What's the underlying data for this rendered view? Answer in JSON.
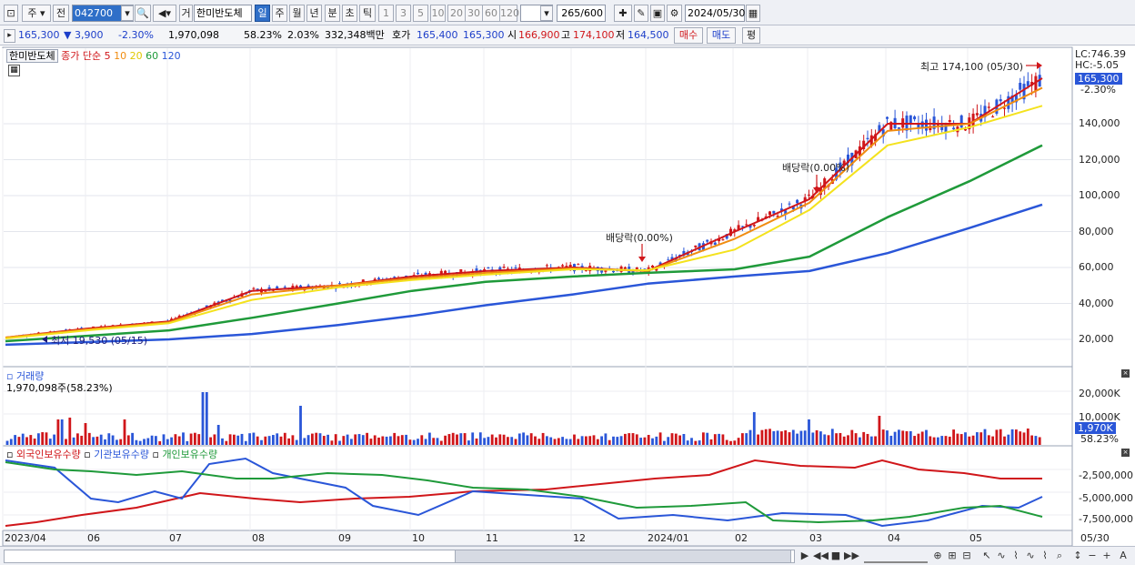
{
  "toolbar": {
    "period_label": "주",
    "prev_label": "전",
    "stock_code": "042700",
    "group_label": "거",
    "stock_name": "한미반도체",
    "tabs": [
      "일",
      "주",
      "월",
      "년",
      "분",
      "초",
      "틱"
    ],
    "active_tab": "일",
    "intervals": [
      "1",
      "3",
      "5",
      "10",
      "20",
      "30",
      "60",
      "120"
    ],
    "count_value": "265",
    "count_total": "/600",
    "date_value": "2024/05/30"
  },
  "quote": {
    "price": "165,300",
    "change": "▼ 3,900",
    "change_pct": "-2.30%",
    "volume": "1,970,098",
    "turnover_pct": "58.23%",
    "ratio": "2.03%",
    "amount": "332,348백만",
    "bid_label": "호가",
    "bid1": "165,400",
    "bid2": "165,300",
    "open_label": "시",
    "open": "166,900",
    "high_label": "고",
    "high": "174,100",
    "low_label": "저",
    "low": "164,500",
    "buy_label": "매수",
    "sell_label": "매도",
    "eval_label": "평"
  },
  "legend": {
    "stock": "한미반도체",
    "ma_title": "종가 단순",
    "ma_periods": [
      "5",
      "10",
      "20",
      "60",
      "120"
    ],
    "ma_colors": [
      "#d0161a",
      "#f08c10",
      "#f4e21e",
      "#1f9a3a",
      "#2a56d8"
    ]
  },
  "price_axis": {
    "ticks": [
      "140,000",
      "120,000",
      "100,000",
      "80,000",
      "60,000",
      "40,000",
      "20,000"
    ],
    "lc": "LC:746.39",
    "hc": "HC:-5.05",
    "last_price": "165,300",
    "last_pct": "-2.30%"
  },
  "annotations": {
    "high": "최고 174,100 (05/30)",
    "low": "최저 19,530 (05/15)",
    "div1": "배당락(0.00%)",
    "div2": "배당락(0.00%)"
  },
  "volume": {
    "title": "거래량",
    "value": "1,970,098주(58.23%)",
    "ticks": [
      "20,000K",
      "10,000K"
    ],
    "last": "1,970K",
    "last_pct": "58.23%"
  },
  "holdings": {
    "series": [
      "외국인보유수량",
      "기관보유수량",
      "개인보유수량"
    ],
    "colors": [
      "#d0161a",
      "#2a56d8",
      "#1f9a3a"
    ],
    "ticks": [
      "-2,500,000",
      "-5,000,000",
      "-7,500,000"
    ]
  },
  "x_axis": {
    "labels": [
      "2023/04",
      "06",
      "07",
      "08",
      "09",
      "10",
      "11",
      "12",
      "2024/01",
      "02",
      "03",
      "04",
      "05"
    ],
    "end_label": "05/30"
  },
  "chart_data": [
    {
      "type": "line",
      "title": "",
      "ylim": [
        0,
        180000
      ],
      "series": [
        {
          "name": "5",
          "values": [
            21000,
            26000,
            30000,
            47000,
            50000,
            55000,
            58000,
            60000,
            58000,
            80000,
            98000,
            140000,
            140000,
            165300
          ]
        },
        {
          "name": "10",
          "values": [
            21000,
            25500,
            29500,
            45000,
            50000,
            54000,
            57000,
            59500,
            58000,
            76000,
            96000,
            136000,
            140000,
            160000
          ]
        },
        {
          "name": "20",
          "values": [
            20500,
            25000,
            29000,
            42000,
            49000,
            53000,
            56000,
            59000,
            58500,
            70000,
            92000,
            128000,
            138000,
            150000
          ]
        },
        {
          "name": "60",
          "values": [
            19000,
            22000,
            25000,
            32000,
            40000,
            47000,
            52000,
            55000,
            57000,
            59000,
            66000,
            88000,
            108000,
            128000
          ]
        },
        {
          "name": "120",
          "values": [
            17000,
            18500,
            20000,
            23000,
            28000,
            33000,
            39000,
            45000,
            51000,
            55000,
            58000,
            68000,
            82000,
            95000
          ]
        }
      ],
      "x": [
        "2023/04",
        "06",
        "07",
        "08",
        "09",
        "10",
        "11",
        "12",
        "2024/01",
        "02",
        "03",
        "04",
        "05",
        "05/30"
      ]
    }
  ]
}
